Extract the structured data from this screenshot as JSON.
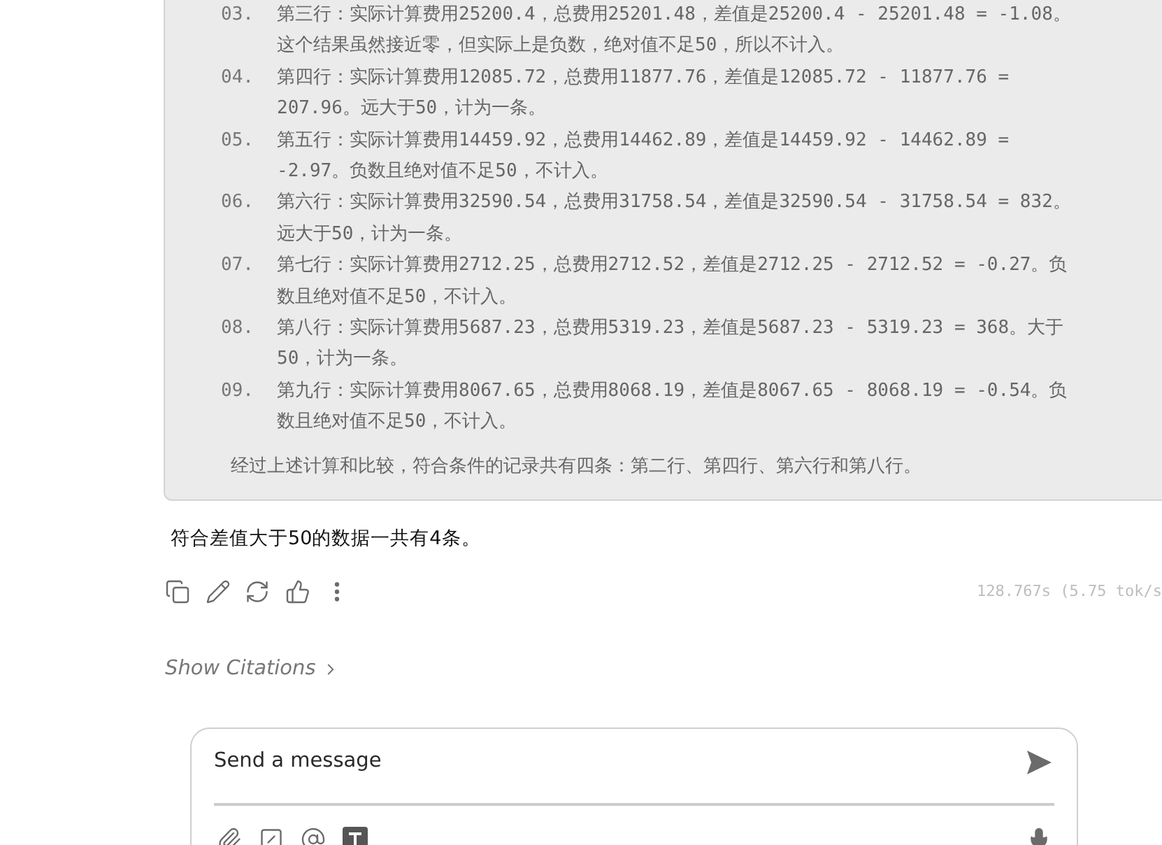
{
  "reasoning_block": {
    "items": [
      {
        "number": "03.",
        "text": "第三行：实际计算费用25200.4，总费用25201.48，差值是25200.4 - 25201.48 = -1.08。这个结果虽然接近零，但实际上是负数，绝对值不足50，所以不计入。"
      },
      {
        "number": "04.",
        "text": "第四行：实际计算费用12085.72，总费用11877.76，差值是12085.72 - 11877.76 = 207.96。远大于50，计为一条。"
      },
      {
        "number": "05.",
        "text": "第五行：实际计算费用14459.92，总费用14462.89，差值是14459.92 - 14462.89 = -2.97。负数且绝对值不足50，不计入。"
      },
      {
        "number": "06.",
        "text": "第六行：实际计算费用32590.54，总费用31758.54，差值是32590.54 - 31758.54 = 832。远大于50，计为一条。"
      },
      {
        "number": "07.",
        "text": "第七行：实际计算费用2712.25，总费用2712.52，差值是2712.25 - 2712.52 = -0.27。负数且绝对值不足50，不计入。"
      },
      {
        "number": "08.",
        "text": "第八行：实际计算费用5687.23，总费用5319.23，差值是5687.23 - 5319.23 = 368。大于50，计为一条。"
      },
      {
        "number": "09.",
        "text": "第九行：实际计算费用8067.65，总费用8068.19，差值是8067.65 - 8068.19 = -0.54。负数且绝对值不足50，不计入。"
      }
    ],
    "summary": "经过上述计算和比较，符合条件的记录共有四条：第二行、第四行、第六行和第八行。"
  },
  "answer": "符合差值大于50的数据一共有4条。",
  "message_actions": {
    "timing": "128.767s (5.75 tok/s"
  },
  "citations": {
    "label": "Show Citations"
  },
  "composer": {
    "placeholder": "Send a message"
  }
}
